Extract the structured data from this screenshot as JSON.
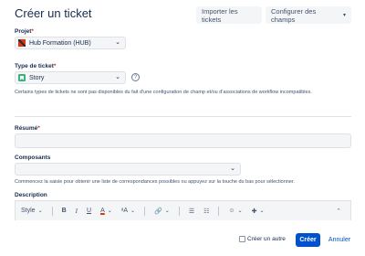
{
  "dialog": {
    "title": "Créer un ticket",
    "import_label": "Importer les tickets",
    "configure_label": "Configurer des champs",
    "configure_icon": "chevron-down-icon"
  },
  "project": {
    "label": "Projet",
    "required_mark": "*",
    "value": "Hub Formation (HUB)",
    "icon": "project-avatar-icon"
  },
  "issue_type": {
    "label": "Type de ticket",
    "required_mark": "*",
    "value": "Story",
    "icon": "story-icon",
    "help_glyph": "?",
    "note": "Certains types de tickets ne sont pas disponibles du fait d'une configuration de champ et/ou d'associations de workflow incompatibles."
  },
  "summary": {
    "label": "Résumé",
    "required_mark": "*",
    "value": ""
  },
  "components": {
    "label": "Composants",
    "value": "",
    "hint": "Commencez la saisie pour obtenir une liste de correspondances possibles ou appuyez sur la touche du bas pour sélectionner."
  },
  "description": {
    "label": "Description",
    "toolbar": {
      "style": "Style",
      "bold": "B",
      "italic": "I",
      "underline": "U",
      "color": "A",
      "text_size": "ᵃA",
      "link": "🔗",
      "bullet": "☰",
      "numbered": "☷",
      "emoji": "☺",
      "insert": "✚",
      "more": "⌃"
    }
  },
  "footer": {
    "create_another": "Créer un autre",
    "create_another_checked": false,
    "create": "Créer",
    "cancel": "Annuler"
  },
  "colors": {
    "primary": "#0052cc",
    "required": "#de350b",
    "story": "#36b37e",
    "text": "#172b4d"
  }
}
